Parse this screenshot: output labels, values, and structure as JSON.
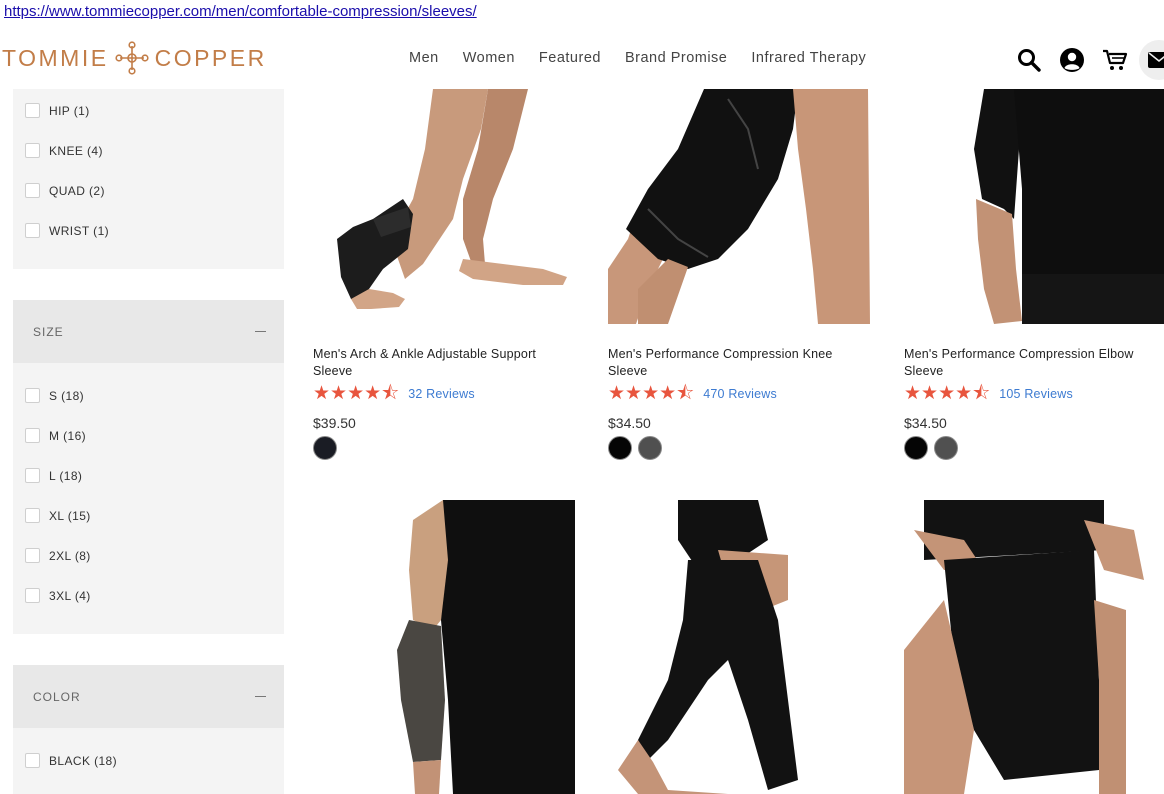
{
  "url": "https://www.tommiecopper.com/men/comfortable-compression/sleeves/",
  "brand": {
    "left": "TOMMIE",
    "right": "COPPER",
    "color": "#c27d48"
  },
  "nav": [
    "Men",
    "Women",
    "Featured",
    "Brand Promise",
    "Infrared Therapy"
  ],
  "header_icons": [
    "search-icon",
    "account-icon",
    "cart-icon",
    "mail-icon"
  ],
  "filters": {
    "area_options": [
      "HIP (1)",
      "KNEE (4)",
      "QUAD (2)",
      "WRIST (1)"
    ],
    "size": {
      "label": "SIZE",
      "options": [
        "S (18)",
        "M (16)",
        "L (18)",
        "XL (15)",
        "2XL (8)",
        "3XL (4)"
      ]
    },
    "color": {
      "label": "COLOR",
      "options": [
        "BLACK (18)"
      ]
    }
  },
  "products": [
    {
      "title": "Men's Arch & Ankle Adjustable Support Sleeve",
      "reviews": "32 Reviews",
      "price": "$39.50",
      "rating": 4.5,
      "swatches": [
        "#1a1c24"
      ]
    },
    {
      "title": "Men's Performance Compression Knee Sleeve",
      "reviews": "470 Reviews",
      "price": "$34.50",
      "rating": 4.5,
      "swatches": [
        "#050505",
        "#505050"
      ]
    },
    {
      "title": "Men's Performance Compression Elbow Sleeve",
      "reviews": "105 Reviews",
      "price": "$34.50",
      "rating": 4.5,
      "swatches": [
        "#050505",
        "#505050"
      ]
    },
    {
      "title": "",
      "reviews": "",
      "price": "",
      "rating": null,
      "swatches": []
    },
    {
      "title": "",
      "reviews": "",
      "price": "",
      "rating": null,
      "swatches": []
    },
    {
      "title": "",
      "reviews": "",
      "price": "",
      "rating": null,
      "swatches": []
    }
  ],
  "colors": {
    "star": "#e8553e",
    "link": "#3d7bd1",
    "sidebar_bg": "#f4f4f4",
    "sidebar_head_bg": "#e8e8e8"
  }
}
